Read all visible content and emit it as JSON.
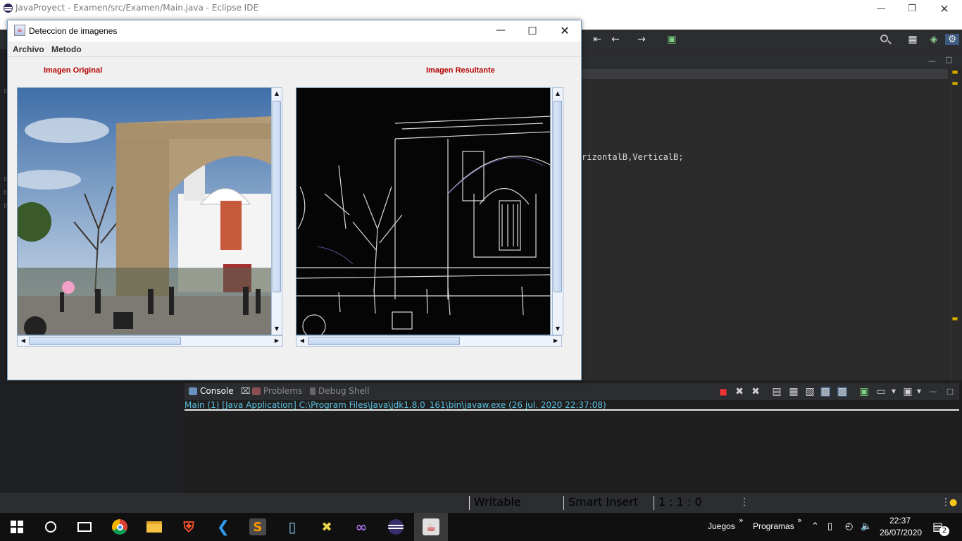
{
  "eclipse": {
    "title": "JavaProyect - Examen/src/Examen/Main.java - Eclipse IDE",
    "code_fragment": "rizontalB,VerticalB;",
    "console": {
      "tabs": [
        {
          "label": "Console",
          "active": true
        },
        {
          "label": "Problems",
          "active": false
        },
        {
          "label": "Debug Shell",
          "active": false
        }
      ],
      "launch_info": "Main (1) [Java Application] C:\\Program Files\\Java\\jdk1.8.0_161\\bin\\javaw.exe  (26 jul. 2020 22:37:08)"
    },
    "status": {
      "writable": "Writable",
      "insert_mode": "Smart Insert",
      "position": "1 : 1 : 0"
    }
  },
  "dialog": {
    "title": "Deteccion de imagenes",
    "menu": [
      "Archivo",
      "Metodo"
    ],
    "left_label": "Imagen Original",
    "right_label": "Imagen Resultante"
  },
  "taskbar": {
    "toolbars": [
      "Juegos",
      "Programas"
    ],
    "time": "22:37",
    "date": "26/07/2020",
    "notifications": "2",
    "apps": [
      "start-icon",
      "search-icon",
      "task-view-icon",
      "chrome-icon",
      "file-explorer-icon",
      "brave-icon",
      "vscode-icon",
      "sublime-icon",
      "notepad-icon",
      "excel-icon",
      "visual-studio-icon",
      "eclipse-icon",
      "java-icon"
    ]
  },
  "colors": {
    "panel_label": "#b30000",
    "console_link": "#5cc0e0",
    "dark_bg": "#2b2b2b"
  }
}
